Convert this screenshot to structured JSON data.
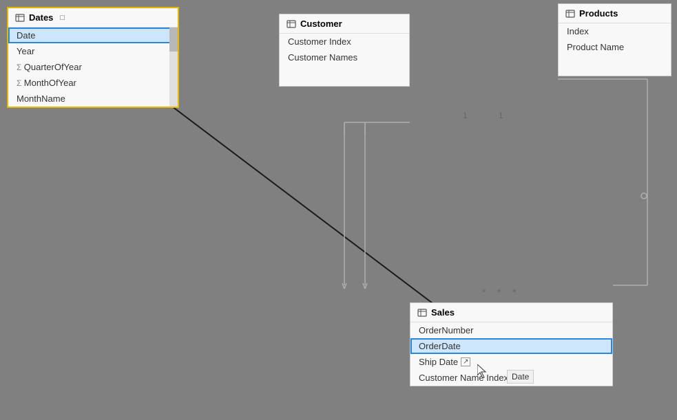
{
  "dates_table": {
    "title": "Dates",
    "rows": [
      "Date",
      "Year",
      "QuarterOfYear",
      "MonthOfYear",
      "MonthName"
    ],
    "sigma_rows": [
      "QuarterOfYear",
      "MonthOfYear"
    ],
    "selected_row": "Date"
  },
  "customer_table": {
    "title": "Customer",
    "rows": [
      "Customer Index",
      "Customer Names"
    ]
  },
  "products_table": {
    "title": "Products",
    "rows": [
      "Index",
      "Product Name"
    ]
  },
  "sales_table": {
    "title": "Sales",
    "rows": [
      "OrderNumber",
      "OrderDate",
      "Ship Date",
      "Customer Name Index"
    ],
    "selected_row": "OrderDate"
  },
  "tooltip": {
    "text": "Date"
  },
  "relation_labels": {
    "one1": "1",
    "one2": "1",
    "many1": "*",
    "many2": "*",
    "many3": "*"
  }
}
